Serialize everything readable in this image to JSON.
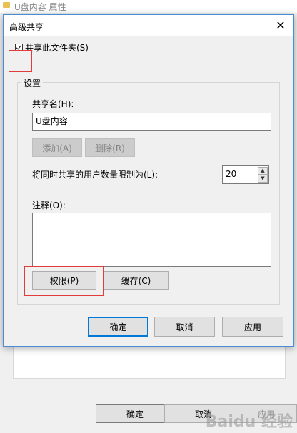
{
  "background_window": {
    "title": "U盘内容 属性",
    "ok_label": "确定",
    "cancel_label": "取消",
    "apply_label": "应用"
  },
  "dialog": {
    "title": "高级共享",
    "close_glyph": "✕",
    "share_checkbox": {
      "label": "共享此文件夹(S)",
      "checked": true
    },
    "settings_group_label": "设置",
    "share_name": {
      "label": "共享名(H):",
      "value": "U盘内容"
    },
    "add_button": "添加(A)",
    "remove_button": "删除(R)",
    "user_limit": {
      "label": "将同时共享的用户数量限制为(L):",
      "value": "20"
    },
    "comment": {
      "label": "注释(O):",
      "value": ""
    },
    "permissions_button": "权限(P)",
    "caching_button": "缓存(C)",
    "ok_button": "确定",
    "cancel_button": "取消",
    "apply_button": "应用"
  },
  "watermark": "Baidu 经验",
  "colors": {
    "accent": "#0078d7",
    "highlight_box": "#e33b3b"
  }
}
